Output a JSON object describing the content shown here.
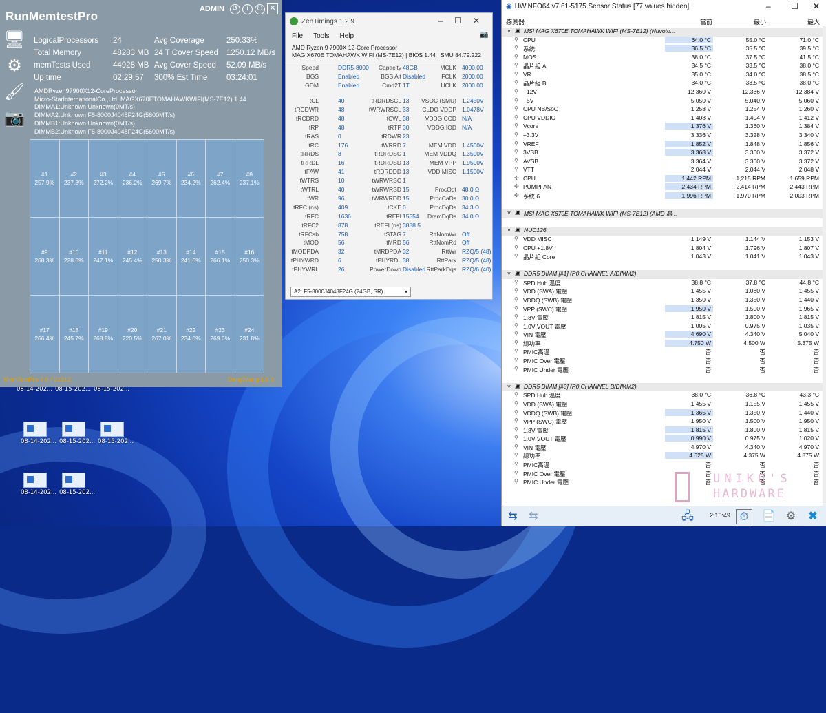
{
  "rmt": {
    "title": "RunMemtestPro",
    "admin": "ADMIN",
    "stats": [
      {
        "label": "LogicalProcessors",
        "value": "24",
        "label2": "Avg Coverage",
        "value2": "250.33%"
      },
      {
        "label": "Total Memory",
        "value": "48283 MB",
        "label2": "24 T Cover Speed",
        "value2": "1250.12 MB/s"
      },
      {
        "label": "memTests Used",
        "value": "44928 MB",
        "label2": "Avg Cover Speed",
        "value2": "52.09 MB/s"
      },
      {
        "label": "Up time",
        "value": "02:29:57",
        "label2": "300% Est Time",
        "value2": "03:24:01"
      }
    ],
    "info": [
      "AMDRyzen97900X12-CoreProcessor",
      "Micro-StarInternationalCo.,Ltd. MAGX670ETOMAHAWKWIFI(MS-7E12) 1.44",
      "DIMMA1:Unknown Unknown(0MT/s)",
      "DIMMA2:Unknown F5-8000J4048F24G(5600MT/s)",
      "DIMMB1:Unknown Unknown(0MT/s)",
      "DIMMB2:Unknown F5-8000J4048F24G(5600MT/s)"
    ],
    "cells": [
      {
        "id": "#1",
        "pct": "257.9%"
      },
      {
        "id": "#2",
        "pct": "237.3%"
      },
      {
        "id": "#3",
        "pct": "272.2%"
      },
      {
        "id": "#4",
        "pct": "236.2%"
      },
      {
        "id": "#5",
        "pct": "269.7%"
      },
      {
        "id": "#6",
        "pct": "234.2%"
      },
      {
        "id": "#7",
        "pct": "262.4%"
      },
      {
        "id": "#8",
        "pct": "237.1%"
      },
      {
        "id": "#9",
        "pct": "268.3%"
      },
      {
        "id": "#10",
        "pct": "228.6%"
      },
      {
        "id": "#11",
        "pct": "247.1%"
      },
      {
        "id": "#12",
        "pct": "245.4%"
      },
      {
        "id": "#13",
        "pct": "250.3%"
      },
      {
        "id": "#14",
        "pct": "241.6%"
      },
      {
        "id": "#15",
        "pct": "266.1%"
      },
      {
        "id": "#16",
        "pct": "250.3%"
      },
      {
        "id": "#17",
        "pct": "266.4%"
      },
      {
        "id": "#18",
        "pct": "245.7%"
      },
      {
        "id": "#19",
        "pct": "268.8%"
      },
      {
        "id": "#20",
        "pct": "220.5%"
      },
      {
        "id": "#21",
        "pct": "267.0%"
      },
      {
        "id": "#22",
        "pct": "234.0%"
      },
      {
        "id": "#23",
        "pct": "269.6%"
      },
      {
        "id": "#24",
        "pct": "231.8%"
      }
    ],
    "footer_left": "MemTestPro 7.0 / 21812",
    "footer_right": "DangWang 1.0.0"
  },
  "zt": {
    "title": "ZenTimings 1.2.9",
    "menu": [
      "File",
      "Tools",
      "Help"
    ],
    "proc1": "AMD Ryzen 9 7900X 12-Core Processor",
    "proc2": "MAG X670E TOMAHAWK WIFI (MS-7E12) | BIOS 1.44 | SMU 84.79.222",
    "top": [
      [
        "Speed",
        "DDR5-8000",
        "Capacity",
        "48GB",
        "MCLK",
        "4000.00"
      ],
      [
        "BGS",
        "Enabled",
        "BGS Alt",
        "Disabled",
        "FCLK",
        "2000.00"
      ],
      [
        "GDM",
        "Enabled",
        "Cmd2T",
        "1T",
        "UCLK",
        "2000.00"
      ]
    ],
    "timings": [
      [
        "tCL",
        "40",
        "tRDRDSCL",
        "13",
        "VSOC (SMU)",
        "1.2450V"
      ],
      [
        "tRCDWR",
        "48",
        "tWRWRSCL",
        "33",
        "CLDO VDDP",
        "1.0478V"
      ],
      [
        "tRCDRD",
        "48",
        "tCWL",
        "38",
        "VDDG CCD",
        "N/A"
      ],
      [
        "tRP",
        "48",
        "tRTP",
        "30",
        "VDDG IOD",
        "N/A"
      ],
      [
        "tRAS",
        "0",
        "tRDWR",
        "23",
        "",
        ""
      ],
      [
        "tRC",
        "176",
        "tWRRD",
        "7",
        "MEM VDD",
        "1.4500V"
      ],
      [
        "tRRDS",
        "8",
        "tRDRDSC",
        "1",
        "MEM VDDQ",
        "1.3500V"
      ],
      [
        "tRRDL",
        "16",
        "tRDRDSD",
        "13",
        "MEM VPP",
        "1.9500V"
      ],
      [
        "tFAW",
        "41",
        "tRDRDDD",
        "13",
        "VDD MISC",
        "1.1500V"
      ],
      [
        "tWTRS",
        "10",
        "tWRWRSC",
        "1",
        "",
        ""
      ],
      [
        "tWTRL",
        "40",
        "tWRWRSD",
        "15",
        "ProcOdt",
        "48.0 Ω"
      ],
      [
        "tWR",
        "96",
        "tWRWRDD",
        "15",
        "ProcCaDs",
        "30.0 Ω"
      ],
      [
        "tRFC (ns)",
        "409",
        "tCKE",
        "0",
        "ProcDqDs",
        "34.3 Ω"
      ],
      [
        "tRFC",
        "1636",
        "tREFI",
        "15554",
        "DramDqDs",
        "34.0 Ω"
      ],
      [
        "tRFC2",
        "878",
        "tREFI (ns)",
        "3888.5",
        "",
        ""
      ],
      [
        "tRFCsb",
        "758",
        "tSTAG",
        "7",
        "RttNomWr",
        "Off"
      ],
      [
        "tMOD",
        "56",
        "tMRD",
        "56",
        "RttNomRd",
        "Off"
      ],
      [
        "tMODPDA",
        "32",
        "tMRDPDA",
        "32",
        "RttWr",
        "RZQ/5 (48)"
      ],
      [
        "tPHYWRD",
        "6",
        "tPHYRDL",
        "38",
        "RttPark",
        "RZQ/5 (48)"
      ],
      [
        "tPHYWRL",
        "26",
        "PowerDown",
        "Disabled",
        "RttParkDqs",
        "RZQ/6 (40)"
      ]
    ],
    "dimm_select": "A2: F5-8000J4048F24G (24GB, SR)"
  },
  "hw": {
    "title": "HWiNFO64 v7.61-5175 Sensor Status [77 values hidden]",
    "cols": [
      "感測器",
      "當前",
      "最小",
      "最大"
    ],
    "rows": [
      {
        "g": 1,
        "n": "MSI MAG X670E TOMAHAWK WIFI (MS-7E12) (Nuvoto..."
      },
      {
        "n": "CPU",
        "c": "64.0 °C",
        "mn": "55.0 °C",
        "mx": "71.0 °C",
        "h": 1
      },
      {
        "n": "系統",
        "c": "36.5 °C",
        "mn": "35.5 °C",
        "mx": "39.5 °C",
        "h": 1
      },
      {
        "n": "MOS",
        "c": "38.0 °C",
        "mn": "37.5 °C",
        "mx": "41.5 °C"
      },
      {
        "n": "晶片組 A",
        "c": "34.5 °C",
        "mn": "33.5 °C",
        "mx": "38.0 °C"
      },
      {
        "n": "VR",
        "c": "35.0 °C",
        "mn": "34.0 °C",
        "mx": "38.5 °C"
      },
      {
        "n": "晶片組 B",
        "c": "34.0 °C",
        "mn": "33.5 °C",
        "mx": "38.0 °C"
      },
      {
        "n": "+12V",
        "c": "12.360 V",
        "mn": "12.336 V",
        "mx": "12.384 V"
      },
      {
        "n": "+5V",
        "c": "5.050 V",
        "mn": "5.040 V",
        "mx": "5.060 V"
      },
      {
        "n": "CPU NB/SoC",
        "c": "1.258 V",
        "mn": "1.254 V",
        "mx": "1.260 V"
      },
      {
        "n": "CPU VDDIO",
        "c": "1.408 V",
        "mn": "1.404 V",
        "mx": "1.412 V"
      },
      {
        "n": "Vcore",
        "c": "1.376 V",
        "mn": "1.360 V",
        "mx": "1.384 V",
        "h": 1
      },
      {
        "n": "+3.3V",
        "c": "3.336 V",
        "mn": "3.328 V",
        "mx": "3.340 V"
      },
      {
        "n": "VREF",
        "c": "1.852 V",
        "mn": "1.848 V",
        "mx": "1.856 V",
        "h": 1
      },
      {
        "n": "3VSB",
        "c": "3.368 V",
        "mn": "3.360 V",
        "mx": "3.372 V",
        "h": 1
      },
      {
        "n": "AVSB",
        "c": "3.364 V",
        "mn": "3.360 V",
        "mx": "3.372 V"
      },
      {
        "n": "VTT",
        "c": "2.044 V",
        "mn": "2.044 V",
        "mx": "2.048 V"
      },
      {
        "n": "CPU",
        "c": "1,442 RPM",
        "mn": "1,215 RPM",
        "mx": "1,659 RPM",
        "h": 1,
        "i": 1
      },
      {
        "n": "PUMPFAN",
        "c": "2,434 RPM",
        "mn": "2,414 RPM",
        "mx": "2,443 RPM",
        "h": 1,
        "i": 1
      },
      {
        "n": "系統 6",
        "c": "1,996 RPM",
        "mn": "1,970 RPM",
        "mx": "2,003 RPM",
        "h": 1,
        "i": 1
      },
      {
        "s": 1
      },
      {
        "g": 1,
        "n": "MSI MAG X670E TOMAHAWK WIFI (MS-7E12) (AMD 晶..."
      },
      {
        "s": 1
      },
      {
        "g": 1,
        "n": "NUC126"
      },
      {
        "n": "VDD MISC",
        "c": "1.149 V",
        "mn": "1.144 V",
        "mx": "1.153 V"
      },
      {
        "n": "CPU +1.8V",
        "c": "1.804 V",
        "mn": "1.796 V",
        "mx": "1.807 V"
      },
      {
        "n": "晶片組 Core",
        "c": "1.043 V",
        "mn": "1.041 V",
        "mx": "1.043 V"
      },
      {
        "s": 1
      },
      {
        "g": 1,
        "n": "DDR5 DIMM [#1] (P0 CHANNEL A/DIMM2)"
      },
      {
        "n": "SPD Hub 溫度",
        "c": "38.8 °C",
        "mn": "37.8 °C",
        "mx": "44.8 °C"
      },
      {
        "n": "VDD (SWA) 電壓",
        "c": "1.455 V",
        "mn": "1.080 V",
        "mx": "1.455 V"
      },
      {
        "n": "VDDQ (SWB) 電壓",
        "c": "1.350 V",
        "mn": "1.350 V",
        "mx": "1.440 V"
      },
      {
        "n": "VPP (SWC) 電壓",
        "c": "1.950 V",
        "mn": "1.500 V",
        "mx": "1.965 V",
        "h": 1
      },
      {
        "n": "1.8V 電壓",
        "c": "1.815 V",
        "mn": "1.800 V",
        "mx": "1.815 V"
      },
      {
        "n": "1.0V VOUT 電壓",
        "c": "1.005 V",
        "mn": "0.975 V",
        "mx": "1.035 V"
      },
      {
        "n": "VIN 電壓",
        "c": "4.690 V",
        "mn": "4.340 V",
        "mx": "5.040 V",
        "h": 1
      },
      {
        "n": "總功率",
        "c": "4.750 W",
        "mn": "4.500 W",
        "mx": "5.375 W",
        "h": 1
      },
      {
        "n": "PMIC高溫",
        "c": "否",
        "mn": "否",
        "mx": "否"
      },
      {
        "n": "PMIC Over 電壓",
        "c": "否",
        "mn": "否",
        "mx": "否"
      },
      {
        "n": "PMIC Under 電壓",
        "c": "否",
        "mn": "否",
        "mx": "否"
      },
      {
        "s": 1
      },
      {
        "g": 1,
        "n": "DDR5 DIMM [#3] (P0 CHANNEL B/DIMM2)"
      },
      {
        "n": "SPD Hub 溫度",
        "c": "38.0 °C",
        "mn": "36.8 °C",
        "mx": "43.3 °C"
      },
      {
        "n": "VDD (SWA) 電壓",
        "c": "1.455 V",
        "mn": "1.155 V",
        "mx": "1.455 V"
      },
      {
        "n": "VDDQ (SWB) 電壓",
        "c": "1.365 V",
        "mn": "1.350 V",
        "mx": "1.440 V",
        "h": 1
      },
      {
        "n": "VPP (SWC) 電壓",
        "c": "1.950 V",
        "mn": "1.500 V",
        "mx": "1.950 V"
      },
      {
        "n": "1.8V 電壓",
        "c": "1.815 V",
        "mn": "1.800 V",
        "mx": "1.815 V",
        "h": 1
      },
      {
        "n": "1.0V VOUT 電壓",
        "c": "0.990 V",
        "mn": "0.975 V",
        "mx": "1.020 V",
        "h": 1
      },
      {
        "n": "VIN 電壓",
        "c": "4.970 V",
        "mn": "4.340 V",
        "mx": "4.970 V"
      },
      {
        "n": "總功率",
        "c": "4.625 W",
        "mn": "4.375 W",
        "mx": "4.875 W",
        "h": 1
      },
      {
        "n": "PMIC高溫",
        "c": "否",
        "mn": "否",
        "mx": "否"
      },
      {
        "n": "PMIC Over 電壓",
        "c": "否",
        "mn": "否",
        "mx": "否"
      },
      {
        "n": "PMIC Under 電壓",
        "c": "否",
        "mn": "否",
        "mx": "否"
      }
    ],
    "clock": "2:15:49"
  },
  "watermark": {
    "line1": "UNIKO'S",
    "line2": "HARDWARE"
  },
  "desktop_labels": [
    "08-14-202...",
    "08-15-202...",
    "08-15-202...",
    "08-14-202...",
    "08-15-202...",
    "08-15-202...",
    "08-14-202...",
    "08-15-202..."
  ]
}
